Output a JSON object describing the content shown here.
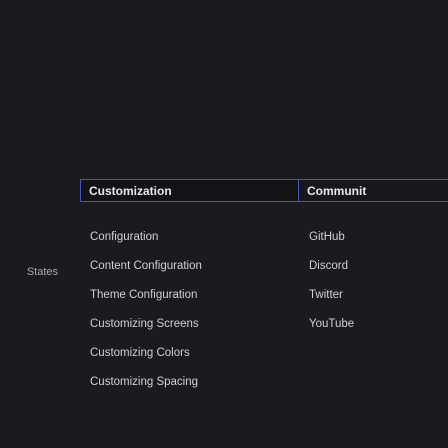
{
  "left_column": {
    "items": [
      "States"
    ]
  },
  "header": {
    "customization_label": "Customization",
    "community_label": "Communit"
  },
  "customization": {
    "links": [
      "Configuration",
      "Content Configuration",
      "Theme Configuration",
      "Customizing Screens",
      "Customizing Colors",
      "Customizing Spacing"
    ]
  },
  "community": {
    "links": [
      "GitHub",
      "Discord",
      "Twitter",
      "YouTube"
    ]
  }
}
